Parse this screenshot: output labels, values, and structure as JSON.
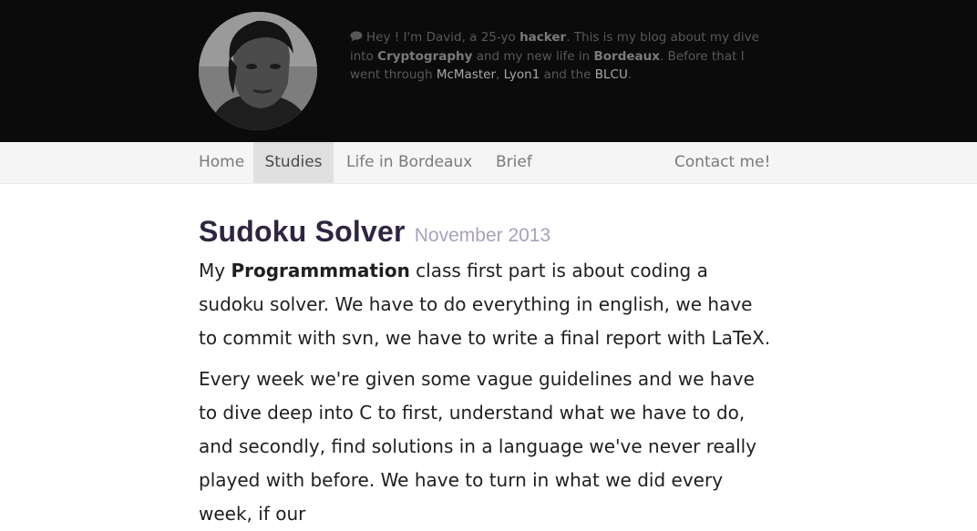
{
  "header": {
    "avatar_alt": "David",
    "bio": {
      "intro": "Hey ! I'm David, a 25-yo ",
      "hacker": "hacker",
      "after_hacker": ". This is my blog about my dive into ",
      "crypto": "Cryptography",
      "after_crypto": " and my new life in ",
      "bordeaux": "Bordeaux",
      "after_bordeaux": ". Before that I went through ",
      "mcmaster": "McMaster",
      "comma": ", ",
      "lyon": "Lyon1",
      "and_the": " and the ",
      "blcu": "BLCU",
      "period": "."
    }
  },
  "nav": {
    "home": "Home",
    "studies": "Studies",
    "life": "Life in Bordeaux",
    "brief": "Brief",
    "contact": "Contact me!"
  },
  "post": {
    "title": "Sudoku Solver",
    "date": "November 2013",
    "p1_before": "My ",
    "p1_bold": "Programmmation",
    "p1_after": " class first part is about coding a sudoku solver. We have to do everything in english, we have to commit with svn, we have to write a final report with LaTeX.",
    "p2": "Every week we're given some vague guidelines and we have to dive deep into C to first, understand what we have to do, and secondly, find solutions in a language we've never really played with before. We have to turn in what we did every week, if our"
  },
  "colors": {
    "header_bg": "#0b0b0b",
    "nav_bg": "#f5f5f5",
    "nav_active_bg": "#e0e0e0",
    "title": "#2e2540",
    "date": "#a9a1bd"
  }
}
